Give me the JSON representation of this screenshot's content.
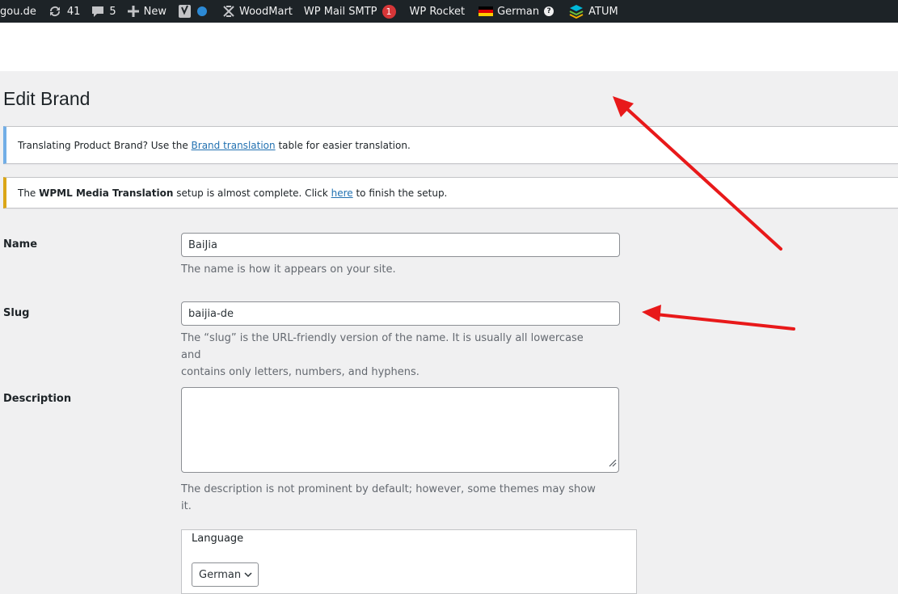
{
  "adminbar": {
    "site": "gou.de",
    "updates_count": "41",
    "comments_count": "5",
    "new_label": "New",
    "woodmart_label": "WoodMart",
    "wpmail_label": "WP Mail SMTP",
    "wpmail_badge": "1",
    "wprocket_label": "WP Rocket",
    "language_label": "German",
    "atum_label": "ATUM"
  },
  "page": {
    "title": "Edit Brand"
  },
  "notices": {
    "translation": {
      "before": "Translating Product Brand? Use the ",
      "link": "Brand translation",
      "after": " table for easier translation."
    },
    "wpml": {
      "before": "The ",
      "bold": "WPML Media Translation",
      "middle": " setup is almost complete. Click ",
      "link": "here",
      "after": " to finish the setup."
    }
  },
  "form": {
    "name": {
      "label": "Name",
      "value": "BaiJia",
      "help": "The name is how it appears on your site."
    },
    "slug": {
      "label": "Slug",
      "value": "baijia-de",
      "help_line1": "The “slug” is the URL-friendly version of the name. It is usually all lowercase and",
      "help_line2": "contains only letters, numbers, and hyphens."
    },
    "description": {
      "label": "Description",
      "value": "",
      "help": "The description is not prominent by default; however, some themes may show it."
    },
    "language": {
      "title": "Language",
      "selected": "German"
    }
  },
  "colors": {
    "adminbar_bg": "#1d2327",
    "link": "#2271b1",
    "notice_info": "#72aee6",
    "notice_warning": "#dba617",
    "badge": "#d63638",
    "annotation_arrow": "#e8191a"
  }
}
